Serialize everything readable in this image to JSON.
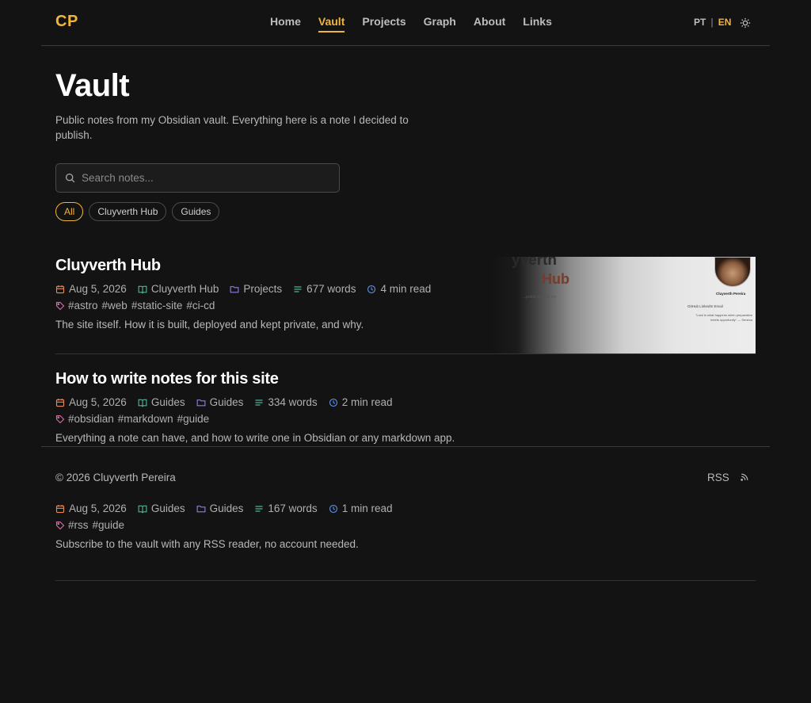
{
  "header": {
    "logo": "CP",
    "nav": [
      "Home",
      "Vault",
      "Projects",
      "Graph",
      "About",
      "Links"
    ],
    "active_nav": "Vault",
    "lang_pt": "PT",
    "lang_sep": "|",
    "lang_en": "EN",
    "theme_icon": "sun-icon"
  },
  "page": {
    "title": "Vault",
    "description": "Public notes from my Obsidian vault. Everything here is a note I decided to publish.",
    "search_placeholder": "Search notes...",
    "chips": [
      "All",
      "Cluyverth Hub",
      "Guides"
    ]
  },
  "notes": [
    {
      "title": "Cluyverth Hub",
      "date": "Aug 5, 2026",
      "collection": "Cluyverth Hub",
      "folder": "Projects",
      "words": "677 words",
      "read": "4 min read",
      "tags": [
        "#astro",
        "#web",
        "#static-site",
        "#ci-cd"
      ],
      "description": "The site itself. How it is built, deployed and kept private, and why.",
      "thumbnail": {
        "title_line1": "yverth",
        "title_line2": "Hub",
        "subtitle": "...public slice of my",
        "name": "Cluyverth Pereira",
        "links": "GitHub   LinkedIn   Email",
        "quote": "\"Luck is what happens when preparation meets opportunity\" — Seneca"
      }
    },
    {
      "title": "How to write notes for this site",
      "date": "Aug 5, 2026",
      "collection": "Guides",
      "folder": "Guides",
      "words": "334 words",
      "read": "2 min read",
      "tags": [
        "#obsidian",
        "#markdown",
        "#guide"
      ],
      "description": "Everything a note can have, and how to write one in Obsidian or any markdown app."
    },
    {
      "date": "Aug 5, 2026",
      "collection": "Guides",
      "folder": "Guides",
      "words": "167 words",
      "read": "1 min read",
      "tags": [
        "#rss",
        "#guide"
      ],
      "description": "Subscribe to the vault with any RSS reader, no account needed."
    }
  ],
  "footer": {
    "copyright": "© 2026 Cluyverth Pereira",
    "rss": "RSS"
  },
  "colors": {
    "accent": "#f2b53c",
    "background": "#131313",
    "calendar_icon": "#e58a5a",
    "collection_icon": "#4fb39a",
    "folder_icon": "#8f7de0",
    "words_icon": "#4fb39a",
    "clock_icon": "#5b8de0",
    "tag_icon": "#d16fa5"
  }
}
